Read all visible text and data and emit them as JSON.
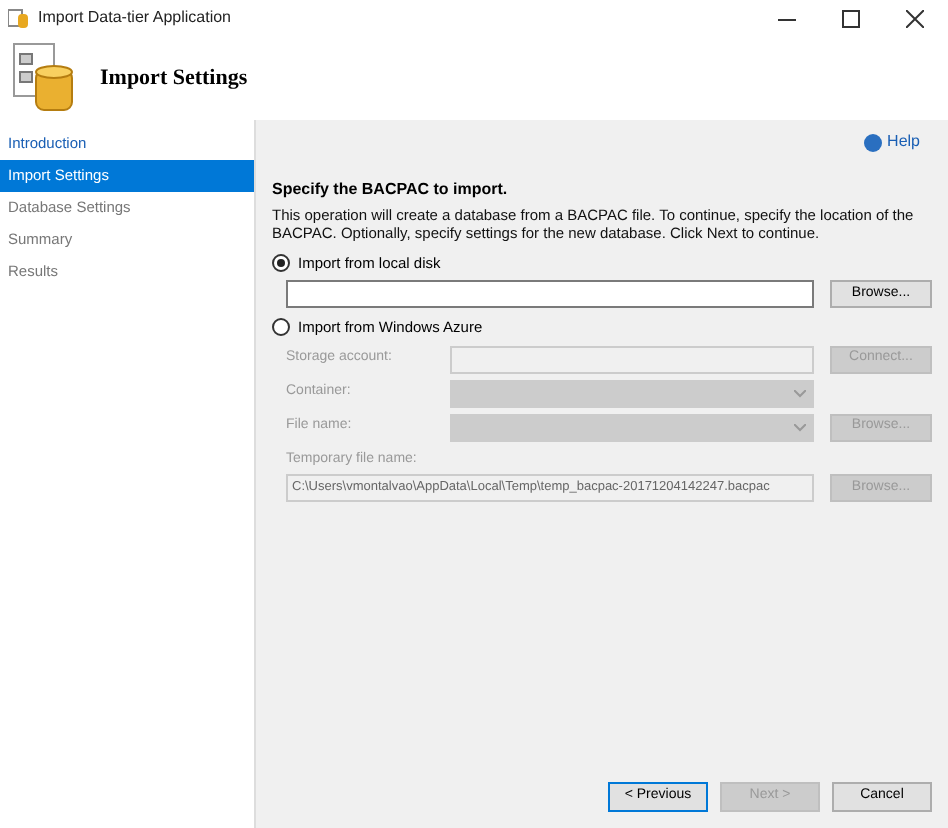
{
  "window": {
    "title": "Import Data-tier Application"
  },
  "header": {
    "title": "Import Settings"
  },
  "sidebar": {
    "items": [
      {
        "label": "Introduction",
        "selected": false,
        "disabled": false
      },
      {
        "label": "Import Settings",
        "selected": true,
        "disabled": false
      },
      {
        "label": "Database Settings",
        "selected": false,
        "disabled": true
      },
      {
        "label": "Summary",
        "selected": false,
        "disabled": true
      },
      {
        "label": "Results",
        "selected": false,
        "disabled": true
      }
    ]
  },
  "help": "Help",
  "heading": "Specify the BACPAC to import.",
  "description": "This operation will create a database from a BACPAC file. To continue, specify the location of the BACPAC. Optionally, specify settings for the new database. Click Next to continue.",
  "sources": [
    {
      "label": "Import from local disk",
      "selected": true
    },
    {
      "label": "Import from Windows Azure",
      "selected": false
    }
  ],
  "local": {
    "button": "Browse..."
  },
  "azure": {
    "rows": [
      {
        "kind": "text",
        "label": "Storage account:",
        "button": "Connect...",
        "disabled": true
      },
      {
        "kind": "dropdown",
        "label": "Container:",
        "disabled": true
      },
      {
        "kind": "dropdown",
        "label": "File name:",
        "button": "Browse...",
        "disabled": true
      }
    ],
    "temp_label": "Temporary file name:",
    "temp_value": "C:\\Users\\vmontalvao\\AppData\\Local\\Temp\\temp_bacpac-20171204142247.bacpac",
    "temp_button": "Browse..."
  },
  "footer": [
    {
      "label": "< Previous",
      "disabled": false,
      "focused": true
    },
    {
      "label": "Next >",
      "disabled": true,
      "focused": false
    },
    {
      "label": "Cancel",
      "disabled": false,
      "focused": false
    }
  ]
}
